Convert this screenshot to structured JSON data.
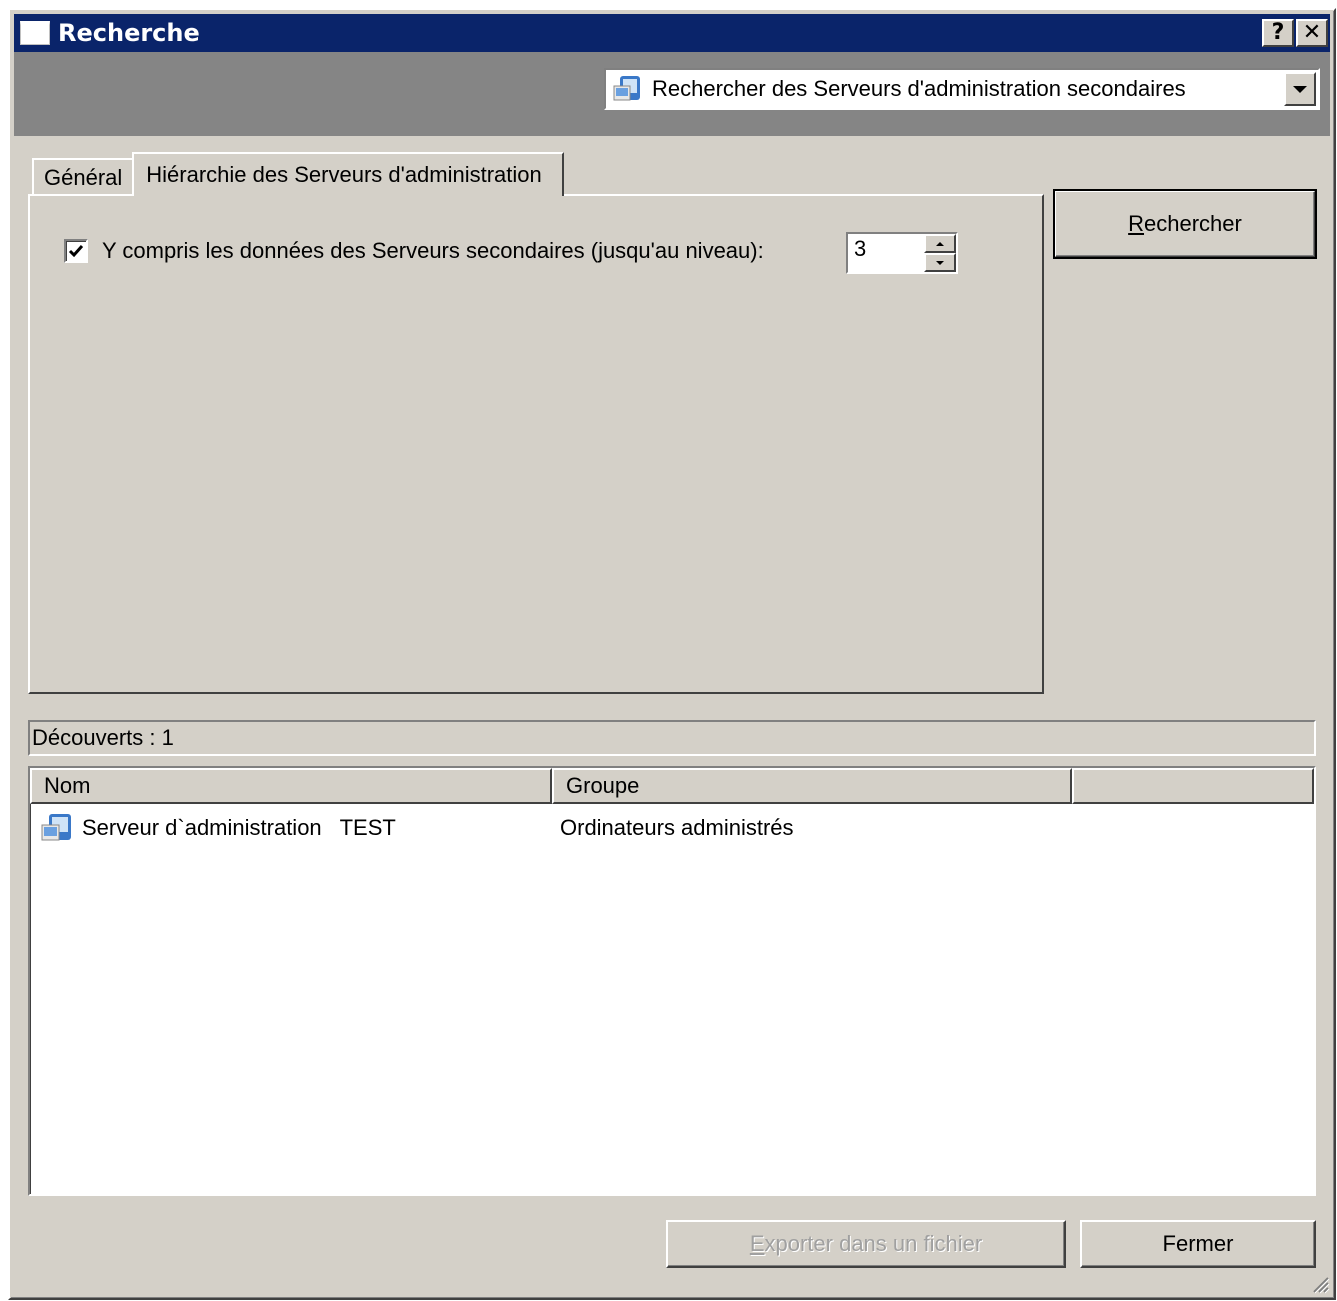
{
  "window": {
    "title": "Recherche",
    "help_label": "?",
    "close_label": "✕"
  },
  "search_type": {
    "selected": "Rechercher des Serveurs d'administration secondaires",
    "icon": "server-icon"
  },
  "tabs": [
    {
      "label": "Général",
      "active": false
    },
    {
      "label": "Hiérarchie des Serveurs d'administration",
      "active": true
    }
  ],
  "hierarchy": {
    "include_label": "Y compris les données des Serveurs secondaires (jusqu'au niveau):",
    "include_checked": true,
    "level_value": "3"
  },
  "buttons": {
    "search": "echercher",
    "search_mnemonic": "R",
    "export": "xporter dans un fichier",
    "export_mnemonic": "E",
    "close": "Fermer"
  },
  "results": {
    "found_label": "Découverts : 1",
    "columns": [
      "Nom",
      "Groupe",
      ""
    ],
    "rows": [
      {
        "name": "Serveur d`administration   TEST",
        "group": "Ordinateurs administrés",
        "icon": "server-icon"
      }
    ]
  },
  "colors": {
    "titlebar": "#0a246a",
    "face": "#d4d0c8",
    "band": "#858585"
  }
}
